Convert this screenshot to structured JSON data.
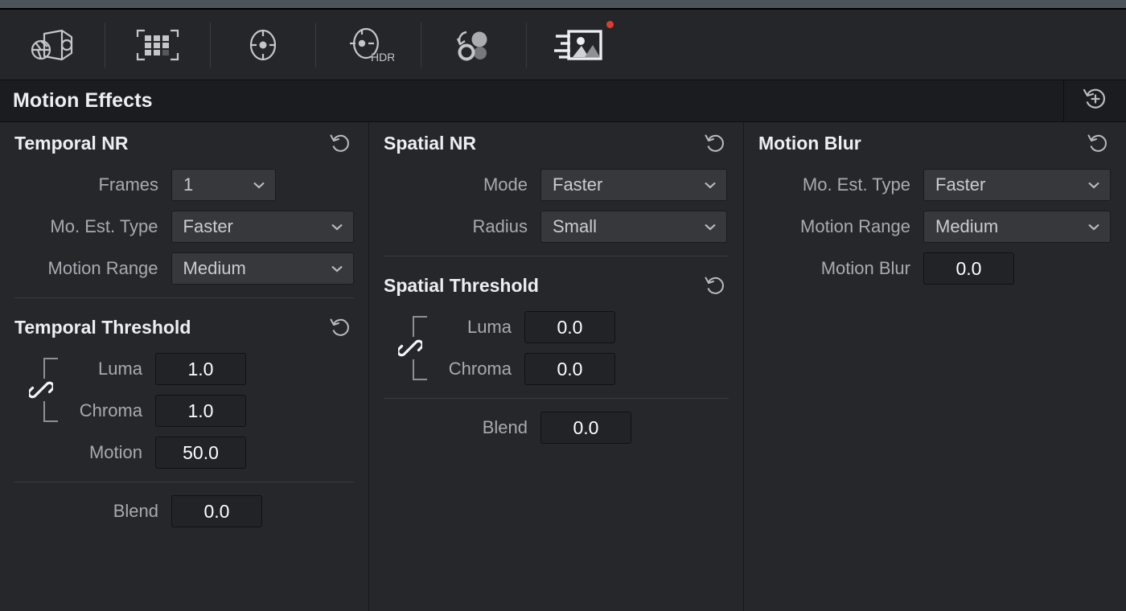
{
  "toolbar": {
    "items": [
      {
        "name": "camera-raw-icon",
        "label": "Camera Raw"
      },
      {
        "name": "color-match-icon",
        "label": "Color Match"
      },
      {
        "name": "color-wheels-icon",
        "label": "Color Wheels"
      },
      {
        "name": "hdr-wheels-icon",
        "label": "HDR Wheels",
        "sublabel": "HDR"
      },
      {
        "name": "blur-icon",
        "label": "Blur"
      },
      {
        "name": "motion-effects-icon",
        "label": "Motion Effects",
        "badge": true
      }
    ]
  },
  "header": {
    "title": "Motion Effects",
    "reset_action_name": "add-version-icon"
  },
  "columns": {
    "temporal": {
      "nr": {
        "title": "Temporal NR",
        "reset_label": "Reset",
        "rows": [
          {
            "label": "Frames",
            "value": "1",
            "type": "dropdown"
          },
          {
            "label": "Mo. Est. Type",
            "value": "Faster",
            "type": "dropdown"
          },
          {
            "label": "Motion Range",
            "value": "Medium",
            "type": "dropdown"
          }
        ]
      },
      "threshold": {
        "title": "Temporal Threshold",
        "reset_label": "Reset",
        "linked": true,
        "rows": [
          {
            "label": "Luma",
            "value": "1.0",
            "type": "value"
          },
          {
            "label": "Chroma",
            "value": "1.0",
            "type": "value"
          },
          {
            "label": "Motion",
            "value": "50.0",
            "type": "value"
          }
        ],
        "blend": {
          "label": "Blend",
          "value": "0.0"
        }
      }
    },
    "spatial": {
      "nr": {
        "title": "Spatial NR",
        "reset_label": "Reset",
        "rows": [
          {
            "label": "Mode",
            "value": "Faster",
            "type": "dropdown"
          },
          {
            "label": "Radius",
            "value": "Small",
            "type": "dropdown"
          }
        ]
      },
      "threshold": {
        "title": "Spatial Threshold",
        "reset_label": "Reset",
        "linked": true,
        "rows": [
          {
            "label": "Luma",
            "value": "0.0",
            "type": "value"
          },
          {
            "label": "Chroma",
            "value": "0.0",
            "type": "value"
          }
        ],
        "blend": {
          "label": "Blend",
          "value": "0.0"
        }
      }
    },
    "motion_blur": {
      "title": "Motion Blur",
      "reset_label": "Reset",
      "rows": [
        {
          "label": "Mo. Est. Type",
          "value": "Faster",
          "type": "dropdown"
        },
        {
          "label": "Motion Range",
          "value": "Medium",
          "type": "dropdown"
        },
        {
          "label": "Motion Blur",
          "value": "0.0",
          "type": "value"
        }
      ]
    }
  },
  "colors": {
    "panel_bg": "#26272b",
    "toolbar_bg": "#252629",
    "titlebar_bg": "#1b1c1f",
    "top_strip": "#4d535a",
    "label_text": "#a7aab0",
    "value_text": "#ffffff",
    "badge_red": "#e33a2e",
    "field_bg": "#222326",
    "dropdown_bg": "#36383c"
  }
}
